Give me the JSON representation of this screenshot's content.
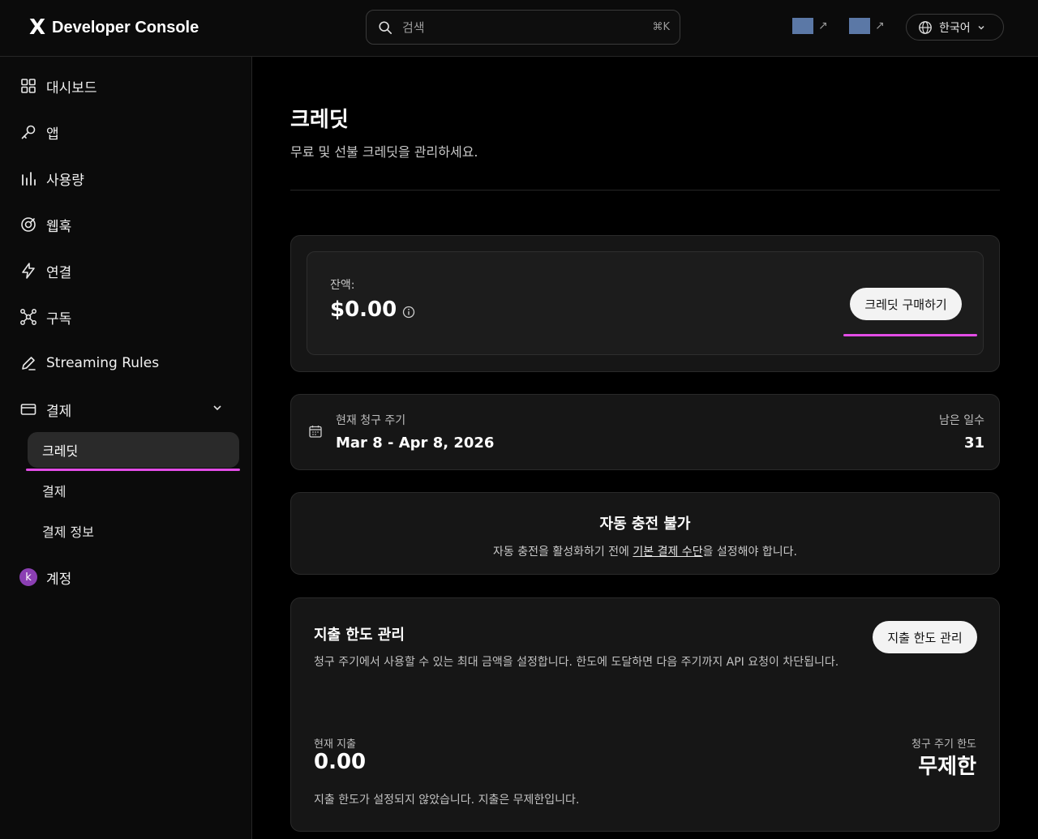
{
  "header": {
    "logo_mark": "X",
    "app_title": "Developer Console",
    "search": {
      "placeholder": "검색",
      "shortcut": "⌘K"
    },
    "external_links": [
      {
        "arrow": "↗"
      },
      {
        "arrow": "↗"
      }
    ],
    "language": {
      "label": "한국어"
    }
  },
  "sidebar": {
    "items": [
      {
        "label": "대시보드",
        "icon": "grid-icon"
      },
      {
        "label": "앱",
        "icon": "key-icon"
      },
      {
        "label": "사용량",
        "icon": "bar-chart-icon"
      },
      {
        "label": "웹훅",
        "icon": "webhook-icon"
      },
      {
        "label": "연결",
        "icon": "lightning-icon"
      },
      {
        "label": "구독",
        "icon": "network-icon"
      },
      {
        "label": "Streaming Rules",
        "icon": "pencil-icon"
      },
      {
        "label": "결제",
        "icon": "card-icon"
      }
    ],
    "billing_sub": [
      {
        "label": "크레딧",
        "active": true
      },
      {
        "label": "결제",
        "active": false
      },
      {
        "label": "결제 정보",
        "active": false
      }
    ],
    "account": {
      "avatar_letter": "k",
      "label": "계정"
    }
  },
  "main": {
    "title": "크레딧",
    "subtitle": "무료 및 선불 크레딧을 관리하세요.",
    "balance": {
      "label": "잔액:",
      "value": "$0.00",
      "buy_button": "크레딧 구매하기"
    },
    "billing_cycle": {
      "label": "현재 청구 주기",
      "range": "Mar 8 - Apr 8, 2026",
      "days_label": "남은 일수",
      "days_value": "31"
    },
    "auto_recharge": {
      "title": "자동 충전 불가",
      "text_before": "자동 충전을 활성화하기 전에 ",
      "link": "기본 결제 수단",
      "text_after": "을 설정해야 합니다."
    },
    "spend_limit": {
      "title": "지출 한도 관리",
      "description": "청구 주기에서 사용할 수 있는 최대 금액을 설정합니다. 한도에 도달하면 다음 주기까지 API 요청이 차단됩니다.",
      "button": "지출 한도 관리",
      "current_label": "현재 지출",
      "current_value": "0.00",
      "limit_label": "청구 주기 한도",
      "limit_value": "무제한",
      "note": "지출 한도가 설정되지 않았습니다. 지출은 무제한입니다."
    }
  },
  "colors": {
    "accent_underline": "#e24de6",
    "avatar": "#8b3fb3",
    "link_thumb": "#5b78a6"
  }
}
